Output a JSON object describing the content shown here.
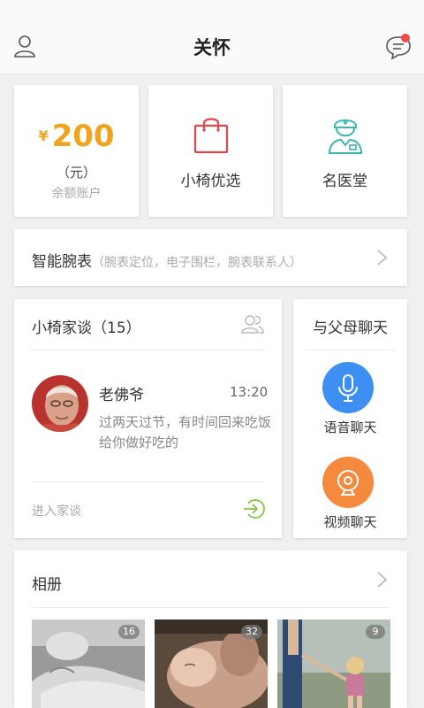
{
  "header": {
    "title": "关怀",
    "user_icon": "user-icon",
    "message_icon": "message-icon",
    "has_unread": true
  },
  "balance": {
    "currency": "¥",
    "amount": "200",
    "unit": "（元）",
    "label": "余额账户"
  },
  "shop": {
    "label": "小椅优选",
    "icon": "shopping-bag-icon"
  },
  "doctor": {
    "label": "名医堂",
    "icon": "doctor-icon"
  },
  "watch": {
    "title": "智能腕表",
    "subtitle": "（腕表定位，电子围栏，腕表联系人）"
  },
  "family_chat": {
    "title": "小椅家谈（15）",
    "message": {
      "name": "老佛爷",
      "time": "13:20",
      "text": "过两天过节，有时间回来吃饭给你做好吃的"
    },
    "enter_label": "进入家谈"
  },
  "parents_chat": {
    "title": "与父母聊天",
    "voice_label": "语音聊天",
    "video_label": "视频聊天"
  },
  "album": {
    "title": "相册",
    "photos": [
      {
        "count": "16"
      },
      {
        "count": "32"
      },
      {
        "count": "9"
      }
    ]
  },
  "colors": {
    "accent_orange": "#f0a31e",
    "voice_blue": "#3d8ff2",
    "video_orange": "#f58a3e",
    "unread_red": "#f04a4a",
    "shop_red": "#e0474c",
    "doctor_teal": "#3bb7b0"
  }
}
